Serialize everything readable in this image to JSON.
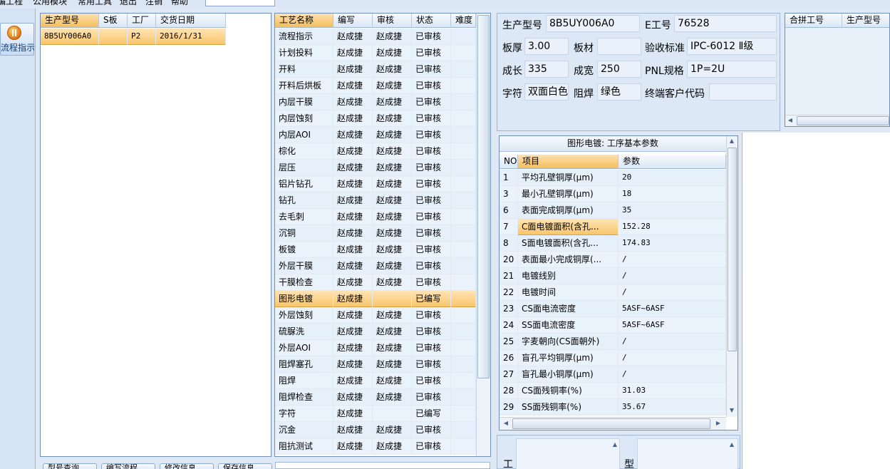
{
  "menubar": {
    "items": [
      "编工程",
      "公用模块",
      "常用工具",
      "退出",
      "注销",
      "帮助"
    ]
  },
  "toolbar": {
    "flow_button_label": "流程指示"
  },
  "orders": {
    "columns": [
      "生产型号",
      "S板",
      "工厂",
      "交货日期"
    ],
    "rows": [
      {
        "model": "8B5UY006A0",
        "s_board": "",
        "factory": "P2",
        "delivery_date": "2016/1/31"
      }
    ]
  },
  "process": {
    "columns": [
      "工艺名称",
      "编写",
      "审核",
      "状态",
      "难度"
    ],
    "selected_index": 16,
    "rows": [
      {
        "name": "流程指示",
        "writer": "赵成捷",
        "reviewer": "赵成捷",
        "status": "已审核",
        "difficulty": ""
      },
      {
        "name": "计划投料",
        "writer": "赵成捷",
        "reviewer": "赵成捷",
        "status": "已审核",
        "difficulty": ""
      },
      {
        "name": "开料",
        "writer": "赵成捷",
        "reviewer": "赵成捷",
        "status": "已审核",
        "difficulty": ""
      },
      {
        "name": "开料后烘板",
        "writer": "赵成捷",
        "reviewer": "赵成捷",
        "status": "已审核",
        "difficulty": ""
      },
      {
        "name": "内层干膜",
        "writer": "赵成捷",
        "reviewer": "赵成捷",
        "status": "已审核",
        "difficulty": ""
      },
      {
        "name": "内层蚀刻",
        "writer": "赵成捷",
        "reviewer": "赵成捷",
        "status": "已审核",
        "difficulty": ""
      },
      {
        "name": "内层AOI",
        "writer": "赵成捷",
        "reviewer": "赵成捷",
        "status": "已审核",
        "difficulty": ""
      },
      {
        "name": "棕化",
        "writer": "赵成捷",
        "reviewer": "赵成捷",
        "status": "已审核",
        "difficulty": ""
      },
      {
        "name": "层压",
        "writer": "赵成捷",
        "reviewer": "赵成捷",
        "status": "已审核",
        "difficulty": ""
      },
      {
        "name": "铝片钻孔",
        "writer": "赵成捷",
        "reviewer": "赵成捷",
        "status": "已审核",
        "difficulty": ""
      },
      {
        "name": "钻孔",
        "writer": "赵成捷",
        "reviewer": "赵成捷",
        "status": "已审核",
        "difficulty": ""
      },
      {
        "name": "去毛刺",
        "writer": "赵成捷",
        "reviewer": "赵成捷",
        "status": "已审核",
        "difficulty": ""
      },
      {
        "name": "沉铜",
        "writer": "赵成捷",
        "reviewer": "赵成捷",
        "status": "已审核",
        "difficulty": ""
      },
      {
        "name": "板镀",
        "writer": "赵成捷",
        "reviewer": "赵成捷",
        "status": "已审核",
        "difficulty": ""
      },
      {
        "name": "外层干膜",
        "writer": "赵成捷",
        "reviewer": "赵成捷",
        "status": "已审核",
        "difficulty": ""
      },
      {
        "name": "干膜检查",
        "writer": "赵成捷",
        "reviewer": "赵成捷",
        "status": "已审核",
        "difficulty": ""
      },
      {
        "name": "图形电镀",
        "writer": "赵成捷",
        "reviewer": "",
        "status": "已编写",
        "difficulty": ""
      },
      {
        "name": "外层蚀刻",
        "writer": "赵成捷",
        "reviewer": "赵成捷",
        "status": "已审核",
        "difficulty": ""
      },
      {
        "name": "硫脲洗",
        "writer": "赵成捷",
        "reviewer": "赵成捷",
        "status": "已审核",
        "difficulty": ""
      },
      {
        "name": "外层AOI",
        "writer": "赵成捷",
        "reviewer": "赵成捷",
        "status": "已审核",
        "difficulty": ""
      },
      {
        "name": "阻焊塞孔",
        "writer": "赵成捷",
        "reviewer": "赵成捷",
        "status": "已审核",
        "difficulty": ""
      },
      {
        "name": "阻焊",
        "writer": "赵成捷",
        "reviewer": "赵成捷",
        "status": "已审核",
        "difficulty": ""
      },
      {
        "name": "阻焊检查",
        "writer": "赵成捷",
        "reviewer": "赵成捷",
        "status": "已审核",
        "difficulty": ""
      },
      {
        "name": "字符",
        "writer": "赵成捷",
        "reviewer": "",
        "status": "已编写",
        "difficulty": ""
      },
      {
        "name": "沉金",
        "writer": "赵成捷",
        "reviewer": "赵成捷",
        "status": "已审核",
        "difficulty": ""
      },
      {
        "name": "阻抗测试",
        "writer": "赵成捷",
        "reviewer": "赵成捷",
        "status": "已审核",
        "difficulty": ""
      }
    ]
  },
  "info": {
    "model_label": "生产型号",
    "model_value": "8B5UY006A0",
    "e_no_label": "E工号",
    "e_no_value": "76528",
    "thickness_label": "板厚",
    "thickness_value": "3.00",
    "material_label": "板材",
    "material_value": "",
    "standard_label": "验收标准",
    "standard_value": "IPC-6012 Ⅱ级",
    "length_label": "成长",
    "length_value": "335",
    "width_label": "成宽",
    "width_value": "250",
    "pnl_label": "PNL规格",
    "pnl_value": "1P=2U",
    "char_label": "字符",
    "char_value": "双面白色",
    "mask_label": "阻焊",
    "mask_value": "绿色",
    "customer_label": "终端客户代码",
    "customer_value": ""
  },
  "merge": {
    "columns": [
      "合拼工号",
      "生产型号"
    ]
  },
  "params": {
    "caption": "图形电镀: 工序基本参数",
    "columns": [
      "NO",
      "项目",
      "参数"
    ],
    "selected_index": 3,
    "rows": [
      {
        "no": "1",
        "item": "平均孔壁铜厚(μm)",
        "value": "20"
      },
      {
        "no": "3",
        "item": "最小孔壁铜厚(μm)",
        "value": "18"
      },
      {
        "no": "6",
        "item": "表面完成铜厚(μm)",
        "value": "35"
      },
      {
        "no": "7",
        "item": "C面电镀面积(含孔...",
        "value": "152.28"
      },
      {
        "no": "8",
        "item": "S面电镀面积(含孔...",
        "value": "174.83"
      },
      {
        "no": "20",
        "item": "表面最小完成铜厚(...",
        "value": "/"
      },
      {
        "no": "21",
        "item": "电镀线别",
        "value": "/"
      },
      {
        "no": "22",
        "item": "电镀时间",
        "value": "/"
      },
      {
        "no": "23",
        "item": "CS面电流密度",
        "value": "5ASF~6ASF"
      },
      {
        "no": "24",
        "item": "SS面电流密度",
        "value": "5ASF~6ASF"
      },
      {
        "no": "25",
        "item": "字麦朝向(CS面朝外)",
        "value": "/"
      },
      {
        "no": "26",
        "item": "盲孔平均铜厚(μm)",
        "value": "/"
      },
      {
        "no": "27",
        "item": "盲孔最小铜厚(μm)",
        "value": "/"
      },
      {
        "no": "28",
        "item": "CS面残铜率(%)",
        "value": "31.03"
      },
      {
        "no": "29",
        "item": "SS面残铜率(%)",
        "value": "35.67"
      }
    ]
  },
  "bottom": {
    "buttons": [
      "型号查询",
      "编写流程",
      "修改信息",
      "保存信息"
    ],
    "label_gong": "工",
    "label_xing": "型"
  },
  "colors": {
    "selection": "#f8c66d",
    "header": "#dbe7f5",
    "row_bg": "#e6f0fb",
    "window_bg": "#dfe9f5"
  }
}
